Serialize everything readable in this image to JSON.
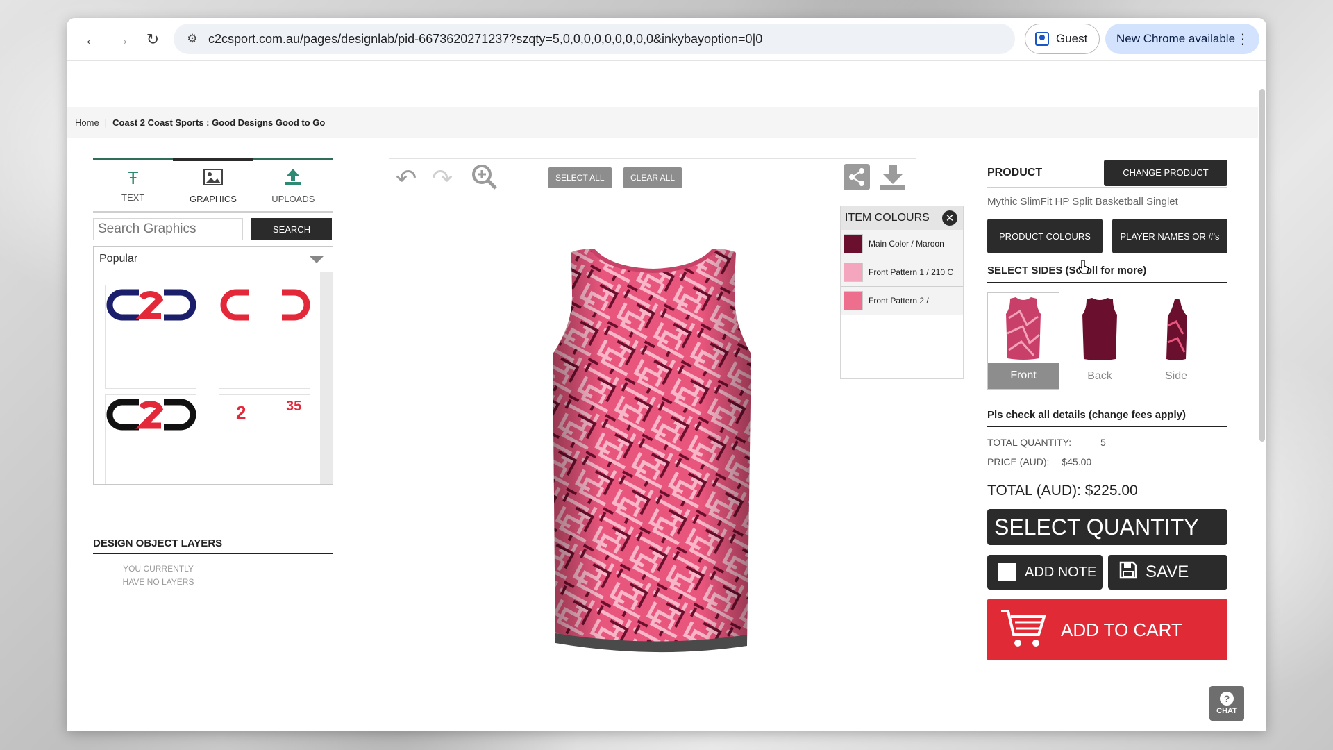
{
  "browser": {
    "url": "c2csport.com.au/pages/designlab/pid-6673620271237?szqty=5,0,0,0,0,0,0,0,0,0&inkybayoption=0|0",
    "profile_label": "Guest",
    "update_label": "New Chrome available"
  },
  "breadcrumb": {
    "home": "Home",
    "separator": "|",
    "current": "Coast 2 Coast Sports : Good Designs Good to Go"
  },
  "left_panel": {
    "tabs": [
      {
        "label": "TEXT",
        "icon": "text-icon"
      },
      {
        "label": "GRAPHICS",
        "icon": "image-icon"
      },
      {
        "label": "UPLOADS",
        "icon": "upload-icon"
      }
    ],
    "search_placeholder": "Search Graphics",
    "search_button": "SEARCH",
    "category_selected": "Popular",
    "gallery_items": [
      {
        "name": "c2c-logo-navy-red"
      },
      {
        "name": "c-bracket-red"
      },
      {
        "name": "c2c-logo-black-red"
      },
      {
        "name": "numbers-2-35",
        "text_a": "2",
        "text_b": "35"
      }
    ]
  },
  "layers": {
    "title": "DESIGN OBJECT LAYERS",
    "empty_text": "YOU CURRENTLY HAVE NO LAYERS"
  },
  "center_toolbar": {
    "select_all": "SELECT ALL",
    "clear_all": "CLEAR ALL",
    "icons": [
      "undo-icon",
      "redo-icon",
      "zoom-in-icon",
      "share-icon",
      "download-icon"
    ]
  },
  "item_colours": {
    "title": "ITEM COLOURS",
    "close": "✕",
    "rows": [
      {
        "label": "Main Color",
        "sep": "/",
        "value": "Maroon",
        "color": "#6b0f2e"
      },
      {
        "label": "Front Pattern 1",
        "sep": "/",
        "value": "210 C",
        "color": "#f4a6be"
      },
      {
        "label": "Front Pattern 2",
        "sep": "/",
        "value": "",
        "color": "#ee6e8e"
      }
    ]
  },
  "product": {
    "label": "PRODUCT",
    "change_button": "CHANGE PRODUCT",
    "name": "Mythic SlimFit HP Split Basketball Singlet",
    "colours_button": "PRODUCT COLOURS",
    "names_button": "PLAYER NAMES OR #'s",
    "sides_title": "SELECT SIDES (Scroll for more)",
    "sides": [
      {
        "label": "Front",
        "active": true
      },
      {
        "label": "Back",
        "active": false
      },
      {
        "label": "Side",
        "active": false
      }
    ],
    "check_title": "Pls check all details (change fees apply)",
    "total_quantity_label": "TOTAL QUANTITY:",
    "total_quantity": "5",
    "price_label": "PRICE (AUD):",
    "price": "$45.00",
    "total_label": "TOTAL (AUD): $225.00",
    "select_quantity": "SELECT QUANTITY",
    "add_note": "ADD NOTE",
    "save": "SAVE",
    "add_to_cart": "ADD TO CART"
  },
  "chat_label": "CHAT",
  "colors": {
    "maroon": "#6b0f2e",
    "pink": "#e8557d",
    "light_pink": "#f4a6be",
    "cart_red": "#e02a36",
    "dark_button": "#2b2b2b"
  }
}
